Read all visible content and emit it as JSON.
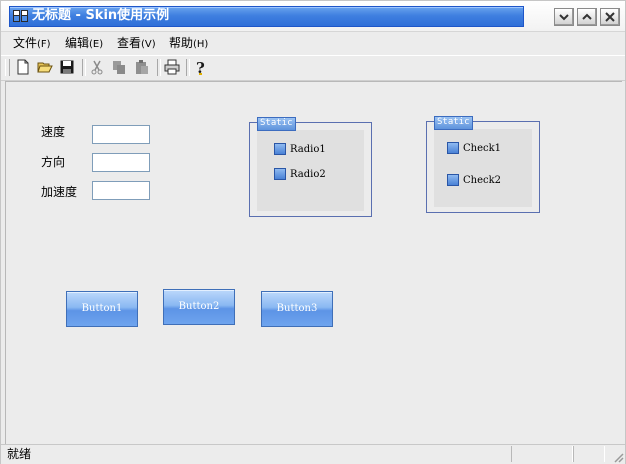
{
  "window": {
    "title": "无标题 - Skin使用示例",
    "controls": [
      "minimize-icon",
      "maximize-icon",
      "close-icon"
    ]
  },
  "menu": {
    "items": [
      {
        "label": "文件",
        "accel": "(F)"
      },
      {
        "label": "编辑",
        "accel": "(E)"
      },
      {
        "label": "查看",
        "accel": "(V)"
      },
      {
        "label": "帮助",
        "accel": "(H)"
      }
    ]
  },
  "toolbar": {
    "buttons": [
      "new-file-icon",
      "open-folder-icon",
      "save-icon",
      "cut-icon",
      "copy-icon",
      "paste-icon",
      "print-icon",
      "help-icon"
    ]
  },
  "form": {
    "speed_label": "速度",
    "direction_label": "方向",
    "accel_label": "加速度",
    "speed_value": "",
    "direction_value": "",
    "accel_value": ""
  },
  "radio_group": {
    "caption": "Static",
    "radio1": "Radio1",
    "radio2": "Radio2"
  },
  "check_group": {
    "caption": "Static",
    "check1": "Check1",
    "check2": "Check2"
  },
  "buttons": {
    "button1": "Button1",
    "button2": "Button2",
    "button3": "Button3"
  },
  "status": {
    "text": "就绪"
  },
  "colors": {
    "title_blue": "#3f7fe0",
    "button_blue": "#6ea4ee",
    "frame_border": "#5a6fb0"
  }
}
